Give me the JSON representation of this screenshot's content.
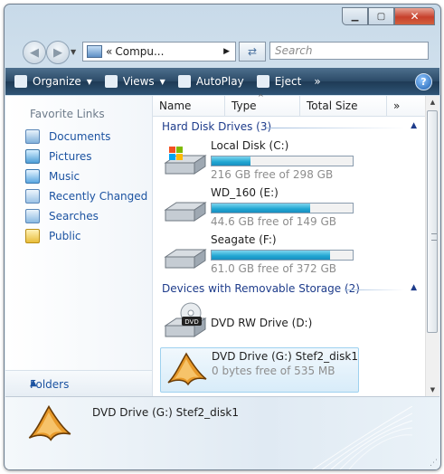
{
  "address": {
    "crumb_prefix": "«",
    "crumb_text": "Compu...",
    "crumb_arrow": "▶"
  },
  "search": {
    "placeholder": "Search"
  },
  "toolbar": {
    "organize": "Organize",
    "views": "Views",
    "autoplay": "AutoPlay",
    "eject": "Eject",
    "more": "»",
    "help": "?"
  },
  "nav_pane": {
    "title": "Favorite Links",
    "items": [
      {
        "label": "Documents",
        "icon": "documents-icon"
      },
      {
        "label": "Pictures",
        "icon": "pictures-icon"
      },
      {
        "label": "Music",
        "icon": "music-icon"
      },
      {
        "label": "Recently Changed",
        "icon": "recently-changed-icon"
      },
      {
        "label": "Searches",
        "icon": "searches-icon"
      },
      {
        "label": "Public",
        "icon": "public-icon"
      }
    ],
    "folders_label": "Folders"
  },
  "columns": {
    "name": "Name",
    "type": "Type",
    "total_size": "Total Size",
    "more": "»"
  },
  "groups": {
    "hdd": "Hard Disk Drives (3)",
    "removable": "Devices with Removable Storage (2)"
  },
  "drives": [
    {
      "name": "Local Disk (C:)",
      "free": "216 GB free of 298 GB",
      "used_fraction": 0.275
    },
    {
      "name": "WD_160 (E:)",
      "free": "44.6 GB free of 149 GB",
      "used_fraction": 0.7
    },
    {
      "name": "Seagate (F:)",
      "free": "61.0 GB free of 372 GB",
      "used_fraction": 0.84
    },
    {
      "name": "DVD RW Drive (D:)"
    },
    {
      "name": "DVD Drive (G:) Stef2_disk1",
      "free": "0 bytes free of 535 MB"
    }
  ],
  "details_pane": {
    "title": "DVD Drive (G:) Stef2_disk1"
  },
  "colors": {
    "toolbar": "#2b4a67",
    "link": "#1c53a1",
    "bar_fill": "#20a6d2",
    "group_header": "#1e3c8b"
  }
}
